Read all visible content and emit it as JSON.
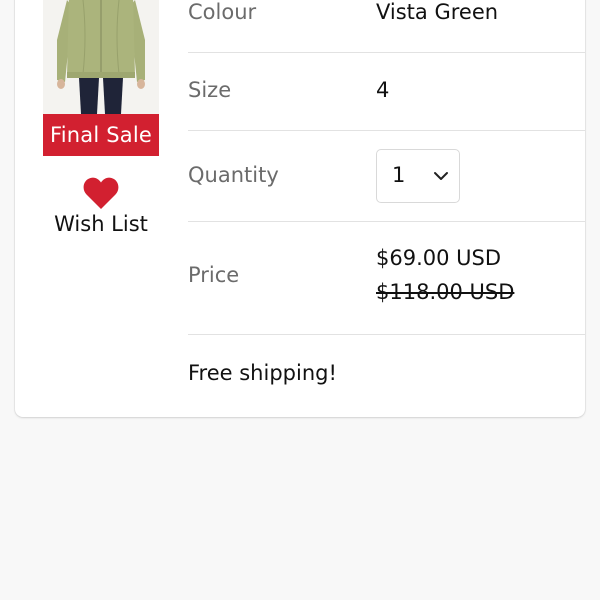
{
  "product": {
    "badge": "Final Sale",
    "wishlist_label": "Wish List"
  },
  "details": {
    "colour_label": "Colour",
    "colour_value": "Vista Green",
    "size_label": "Size",
    "size_value": "4",
    "quantity_label": "Quantity",
    "quantity_value": "1",
    "price_label": "Price",
    "price_current": "$69.00 USD",
    "price_original": "$118.00 USD"
  },
  "shipping_note": "Free shipping!",
  "colors": {
    "badge_red": "#d22030",
    "heart_red": "#d22030",
    "jacket_green": "#a9b27a",
    "page_background": "#f8f8f8"
  },
  "icons": {
    "wishlist": "heart-icon",
    "quantity_dropdown": "chevron-down-icon"
  }
}
